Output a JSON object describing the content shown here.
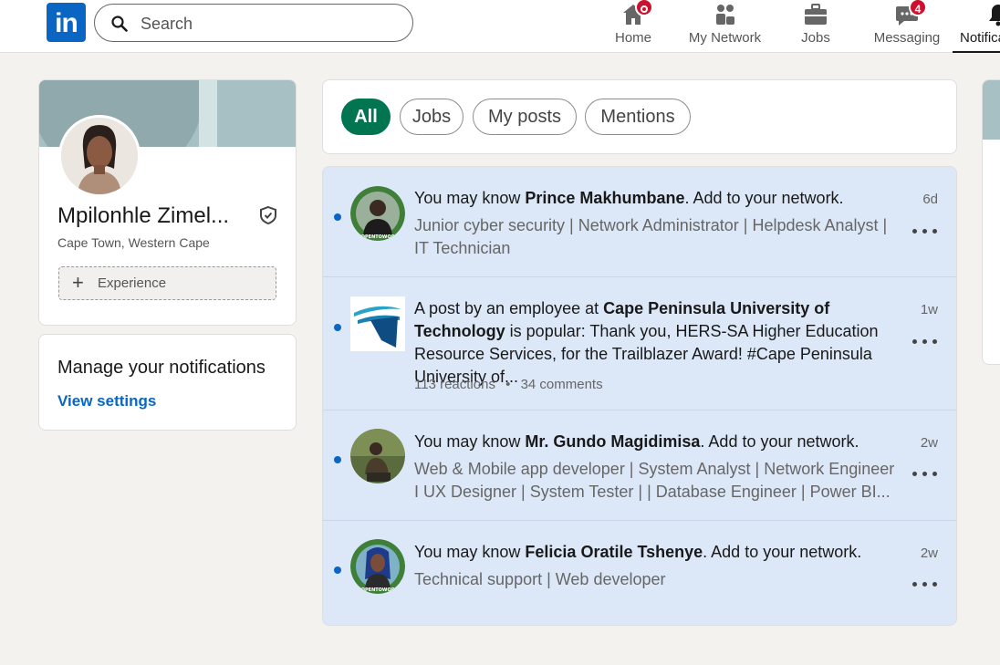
{
  "search": {
    "placeholder": "Search"
  },
  "nav": {
    "home": {
      "label": "Home",
      "badge": ""
    },
    "network": {
      "label": "My Network"
    },
    "jobs": {
      "label": "Jobs"
    },
    "messaging": {
      "label": "Messaging",
      "badge": "4"
    },
    "notifications": {
      "label": "Notifications"
    }
  },
  "profile": {
    "name": "Mpilonhle Zimel...",
    "location": "Cape Town, Western Cape",
    "experience_button": "Experience"
  },
  "manage": {
    "title": "Manage your notifications",
    "link": "View settings"
  },
  "filters": [
    "All",
    "Jobs",
    "My posts",
    "Mentions"
  ],
  "notifications": [
    {
      "prefix": "You may know ",
      "name": "Prince Makhumbane",
      "suffix": ". Add to your network.",
      "subtitle": "Junior cyber security | Network Administrator | Helpdesk Analyst | IT Technician",
      "time": "6d",
      "ring_text": "#OPENTOWORK"
    },
    {
      "prefix": "A post by an employee at ",
      "name": "Cape Peninsula University of Technology",
      "suffix": " is popular: Thank you, HERS-SA Higher Education Resource Services, for the Trailblazer Award! #Cape Peninsula University of...",
      "reactions": "113 reactions",
      "separator": "•",
      "comments": "34 comments",
      "time": "1w"
    },
    {
      "prefix": "You may know ",
      "name": "Mr. Gundo Magidimisa",
      "suffix": ". Add to your network.",
      "subtitle": "Web & Mobile app developer | System Analyst | Network Engineer I UX Designer | System Tester | | Database Engineer | Power BI...",
      "time": "2w"
    },
    {
      "prefix": "You may know ",
      "name": "Felicia Oratile Tshenye",
      "suffix": ". Add to your network.",
      "subtitle": "Technical support | Web developer",
      "time": "2w",
      "ring_text": "#OPENTOWORK"
    }
  ],
  "colors": {
    "brand": "#0a66c2",
    "active_filter": "#01754f",
    "unread_bg": "#dce8f7",
    "badge": "#cb112d"
  }
}
